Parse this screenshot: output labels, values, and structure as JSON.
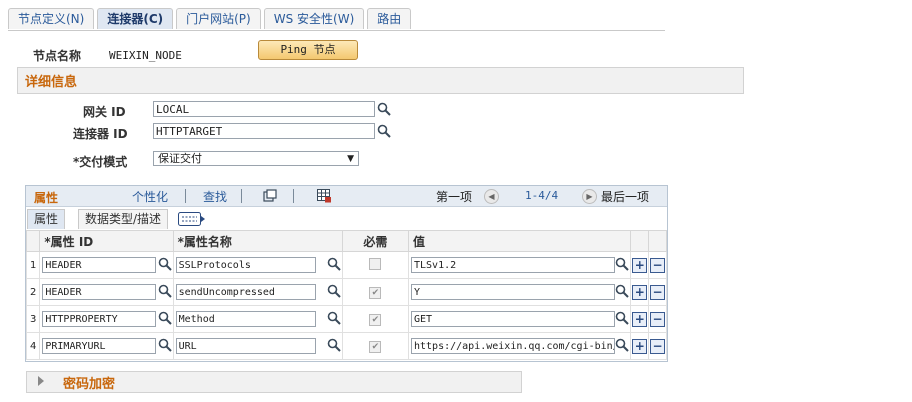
{
  "tabs": [
    "节点定义(N)",
    "连接器(C)",
    "门户网站(P)",
    "WS 安全性(W)",
    "路由"
  ],
  "active_tab": 1,
  "node": {
    "label": "节点名称",
    "value": "WEIXIN_NODE"
  },
  "ping_button": "Ping 节点",
  "details": {
    "title": "详细信息",
    "gateway_label": "网关 ID",
    "gateway_value": "LOCAL",
    "connector_label": "连接器 ID",
    "connector_value": "HTTPTARGET",
    "delivery_label": "*交付模式",
    "delivery_value": "保证交付"
  },
  "properties": {
    "title": "属性",
    "personalize": "个性化",
    "find": "查找",
    "first": "第一项",
    "range": "1-4/4",
    "last": "最后一项",
    "subtabs": [
      "属性",
      "数据类型/描述"
    ],
    "columns": [
      "*属性 ID",
      "*属性名称",
      "必需",
      "值"
    ],
    "rows": [
      {
        "num": "1",
        "id": "HEADER",
        "name": "SSLProtocols",
        "required": false,
        "value": "TLSv1.2"
      },
      {
        "num": "2",
        "id": "HEADER",
        "name": "sendUncompressed",
        "required": true,
        "value": "Y"
      },
      {
        "num": "3",
        "id": "HTTPPROPERTY",
        "name": "Method",
        "required": true,
        "value": "GET"
      },
      {
        "num": "4",
        "id": "PRIMARYURL",
        "name": "URL",
        "required": true,
        "value": "https://api.weixin.qq.com/cgi-bin/"
      }
    ]
  },
  "password_section": "密码加密",
  "colors": {
    "accent_orange": "#c8670c",
    "link_blue": "#2a5a9a",
    "header_bg": "#e6ecf3"
  }
}
